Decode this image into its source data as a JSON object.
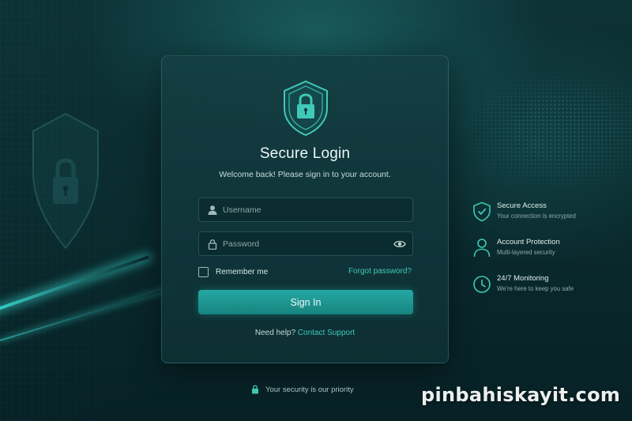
{
  "login": {
    "title": "Secure Login",
    "subtitle": "Welcome back! Please sign in to your account.",
    "username_placeholder": "Username",
    "password_placeholder": "Password",
    "remember_label": "Remember me",
    "forgot_label": "Forgot password?",
    "signin_label": "Sign In",
    "help_text": "Need help?",
    "support_link": "Contact Support"
  },
  "features": [
    {
      "icon": "shield-check-icon",
      "title": "Secure Access",
      "desc": "Your connection is encrypted"
    },
    {
      "icon": "user-icon",
      "title": "Account Protection",
      "desc": "Multi-layered security"
    },
    {
      "icon": "clock-icon",
      "title": "24/7 Monitoring",
      "desc": "We're here to keep you safe"
    }
  ],
  "footer": {
    "text": "Your security is our priority"
  },
  "watermark": "pinbahiskayit.com",
  "colors": {
    "accent": "#3fc9b7",
    "button": "#1f9a96",
    "background": "#0b2c30"
  }
}
